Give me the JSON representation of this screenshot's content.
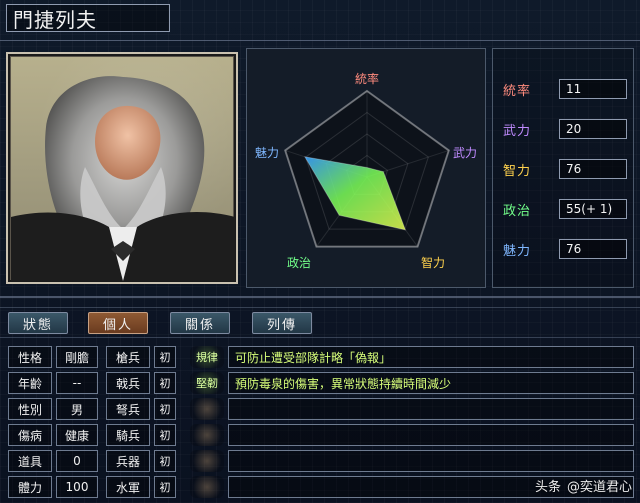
{
  "header": {
    "name": "門捷列夫"
  },
  "radar": {
    "labels": {
      "lead": "統率",
      "war": "武力",
      "int": "智力",
      "pol": "政治",
      "cha": "魅力"
    },
    "values": {
      "lead": 11,
      "war": 20,
      "int": 76,
      "pol": 55,
      "cha": 76
    },
    "max": 100
  },
  "stats": [
    {
      "label": "統率",
      "value": "11",
      "color": "#ff8b7e"
    },
    {
      "label": "武力",
      "value": "20",
      "color": "#c08bff"
    },
    {
      "label": "智力",
      "value": "76",
      "color": "#ffd24d"
    },
    {
      "label": "政治",
      "value": "55(+ 1)",
      "color": "#72ff8a"
    },
    {
      "label": "魅力",
      "value": "76",
      "color": "#7fb7ff"
    }
  ],
  "tabs": [
    {
      "label": "狀態",
      "active": false
    },
    {
      "label": "個人",
      "active": true
    },
    {
      "label": "關係",
      "active": false
    },
    {
      "label": "列傳",
      "active": false
    }
  ],
  "profile": {
    "rows": [
      {
        "k1": "性格",
        "v1": "剛膽",
        "k2": "槍兵",
        "v2": "初"
      },
      {
        "k1": "年齡",
        "v1": "--",
        "k2": "戟兵",
        "v2": "初"
      },
      {
        "k1": "性別",
        "v1": "男",
        "k2": "弩兵",
        "v2": "初"
      },
      {
        "k1": "傷病",
        "v1": "健康",
        "k2": "騎兵",
        "v2": "初"
      },
      {
        "k1": "道具",
        "v1": "0",
        "k2": "兵器",
        "v2": "初"
      },
      {
        "k1": "體力",
        "v1": "100",
        "k2": "水軍",
        "v2": "初"
      }
    ]
  },
  "skills": [
    {
      "name": "規律",
      "desc": "可防止遭受部隊計略「偽報」"
    },
    {
      "name": "堅韌",
      "desc": "預防毒泉的傷害，異常狀態持續時間減少"
    }
  ],
  "watermark": {
    "brand": "头条",
    "handle": "@奕道君心"
  }
}
